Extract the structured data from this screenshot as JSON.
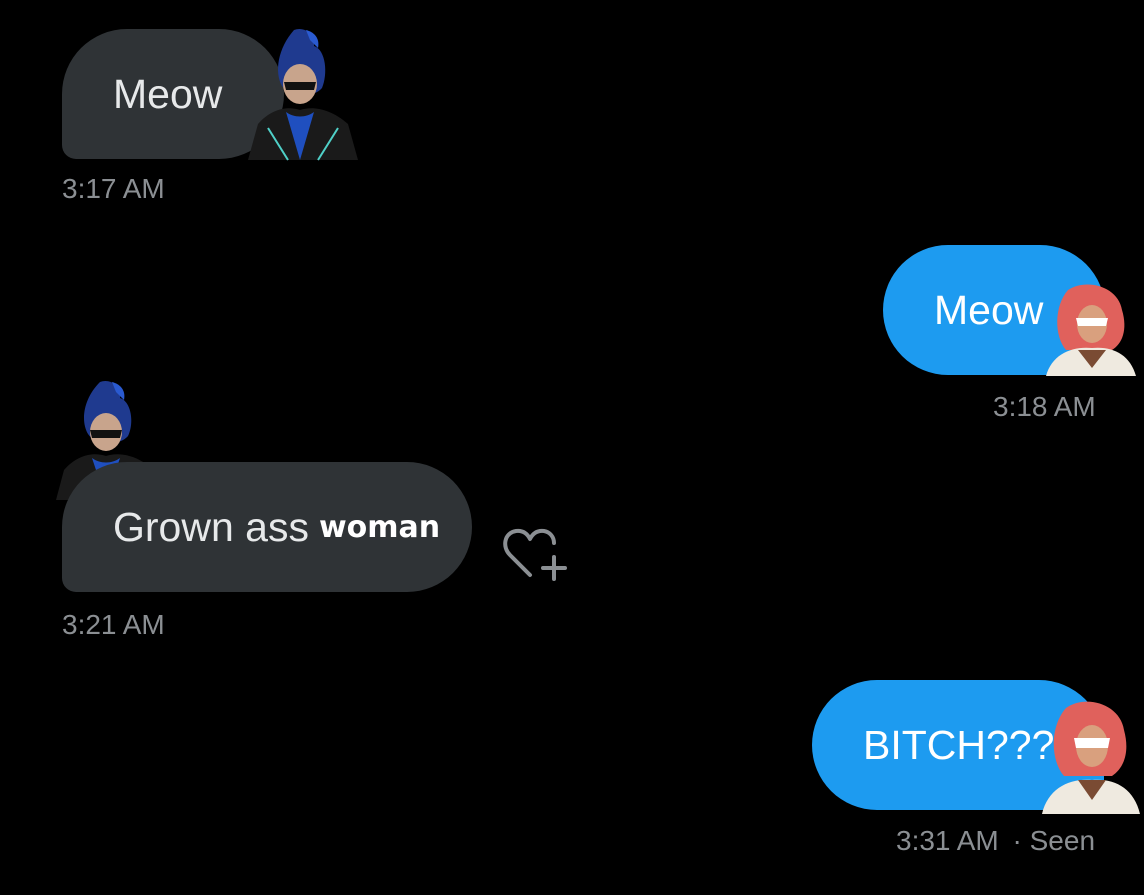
{
  "conversation": {
    "messages": [
      {
        "direction": "incoming",
        "text": "Meow",
        "time": "3:17 AM"
      },
      {
        "direction": "outgoing",
        "text": "Meow",
        "time": "3:18 AM"
      },
      {
        "direction": "incoming",
        "text": "Grown ass",
        "text_bold": "woman",
        "time": "3:21 AM"
      },
      {
        "direction": "outgoing",
        "text": "BITCH???",
        "time": "3:31 AM",
        "status": "· Seen"
      }
    ]
  },
  "icons": {
    "react": "heart-plus-icon",
    "incoming_avatar": "blue-haired-character-sticker",
    "outgoing_avatar": "red-haired-character-sticker"
  },
  "colors": {
    "background": "#000000",
    "incoming_bubble": "#2f3336",
    "outgoing_bubble": "#1d9bf0",
    "timestamp": "#8b8f93"
  }
}
